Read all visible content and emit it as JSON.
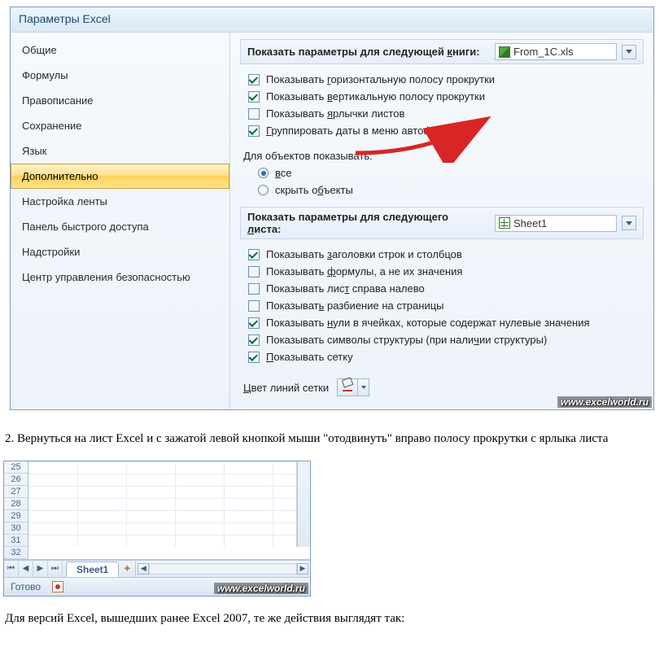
{
  "dialog": {
    "title": "Параметры Excel",
    "sidebar": [
      {
        "label": "Общие",
        "selected": false
      },
      {
        "label": "Формулы",
        "selected": false
      },
      {
        "label": "Правописание",
        "selected": false
      },
      {
        "label": "Сохранение",
        "selected": false
      },
      {
        "label": "Язык",
        "selected": false
      },
      {
        "label": "Дополнительно",
        "selected": true
      },
      {
        "label": "Настройка ленты",
        "selected": false
      },
      {
        "label": "Панель быстрого доступа",
        "selected": false
      },
      {
        "label": "Надстройки",
        "selected": false
      },
      {
        "label": "Центр управления безопасностью",
        "selected": false
      }
    ],
    "workbook_section": {
      "header_html": "Показать параметры для следующей <u>к</u>ниги:",
      "combo_value": "From_1C.xls"
    },
    "wb_options": [
      {
        "checked": true,
        "html": "Показывать <u>г</u>оризонтальную полосу прокрутки"
      },
      {
        "checked": true,
        "html": "Показывать <u>в</u>ертикальную полосу прокрутки"
      },
      {
        "checked": false,
        "html": "Показывать <u>я</u>рлычки листов"
      },
      {
        "checked": true,
        "html": "<u>Г</u>руппировать даты в меню автофильтра"
      }
    ],
    "objects_header": "Для объектов показывать:",
    "objects_radio": [
      {
        "checked": true,
        "html": "<u>в</u>се"
      },
      {
        "checked": false,
        "html": "скрыть о<u>б</u>ъекты"
      }
    ],
    "sheet_section": {
      "header_html": "Показать параметры для следующего <u>л</u>иста:",
      "combo_value": "Sheet1"
    },
    "sheet_options": [
      {
        "checked": true,
        "html": "Показывать <u>з</u>аголовки строк и столбцов"
      },
      {
        "checked": false,
        "html": "Показывать <u>ф</u>ормулы, а не их значения"
      },
      {
        "checked": false,
        "html": "Показывать лис<u>т</u> справа налево"
      },
      {
        "checked": false,
        "html": "Показыват<u>ь</u> разбиение на страницы"
      },
      {
        "checked": true,
        "html": "Показывать <u>н</u>ули в ячейках, которые содержат нулевые значения"
      },
      {
        "checked": true,
        "html": "Показывать символы структуры (при нали<u>ч</u>ии структуры)"
      },
      {
        "checked": true,
        "html": "<u>П</u>оказывать сетку"
      }
    ],
    "gridline_color_label_html": "<u>Ц</u>вет линий сетки"
  },
  "watermark": "www.excelworld.ru",
  "article": {
    "step2": "2. Вернуться на лист Excel и с зажатой левой кнопкой мыши \"отодвинуть\" вправо полосу прокрутки с ярлыка листа",
    "note": "Для версий Excel, вышедших ранее Excel 2007, те же действия выглядят так:"
  },
  "shot2": {
    "rows": [
      "25",
      "26",
      "27",
      "28",
      "29",
      "30",
      "31",
      "32"
    ],
    "tab": "Sheet1",
    "status": "Готово"
  }
}
